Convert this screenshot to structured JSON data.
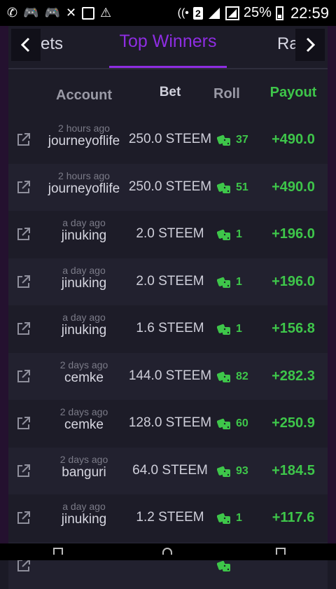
{
  "statusbar": {
    "battery": "25%",
    "time": "22:59",
    "sim_badge": "2"
  },
  "tabs": {
    "left": "ets",
    "active": "Top Winners",
    "right": "Ra"
  },
  "colors": {
    "accent": "#8e2de2",
    "win": "#3ec64a"
  },
  "headers": {
    "account": "Account",
    "bet": "Bet",
    "roll": "Roll",
    "payout": "Payout"
  },
  "rows": [
    {
      "time": "2 hours ago",
      "account": "journeyoflife",
      "bet": "250.0 STEEM",
      "roll": "37",
      "payout": "+490.0"
    },
    {
      "time": "2 hours ago",
      "account": "journeyoflife",
      "bet": "250.0 STEEM",
      "roll": "51",
      "payout": "+490.0"
    },
    {
      "time": "a day ago",
      "account": "jinuking",
      "bet": "2.0 STEEM",
      "roll": "1",
      "payout": "+196.0"
    },
    {
      "time": "a day ago",
      "account": "jinuking",
      "bet": "2.0 STEEM",
      "roll": "1",
      "payout": "+196.0"
    },
    {
      "time": "a day ago",
      "account": "jinuking",
      "bet": "1.6 STEEM",
      "roll": "1",
      "payout": "+156.8"
    },
    {
      "time": "2 days ago",
      "account": "cemke",
      "bet": "144.0 STEEM",
      "roll": "82",
      "payout": "+282.3"
    },
    {
      "time": "2 days ago",
      "account": "cemke",
      "bet": "128.0 STEEM",
      "roll": "60",
      "payout": "+250.9"
    },
    {
      "time": "2 days ago",
      "account": "banguri",
      "bet": "64.0 STEEM",
      "roll": "93",
      "payout": "+184.5"
    },
    {
      "time": "a day ago",
      "account": "jinuking",
      "bet": "1.2 STEEM",
      "roll": "1",
      "payout": "+117.6"
    },
    {
      "time": "2 days ago",
      "account": "",
      "bet": "",
      "roll": "",
      "payout": ""
    }
  ]
}
